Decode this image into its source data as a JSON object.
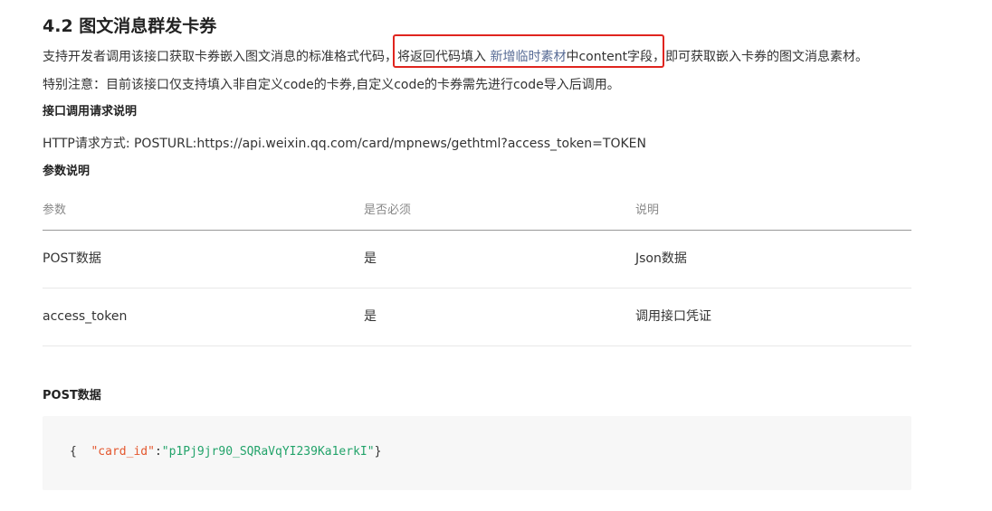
{
  "heading": "4.2 图文消息群发卡券",
  "para1": {
    "before": "支持开发者调用该接口获取卡券嵌入图文消息的标准格式代码，",
    "boxed_before": "将返回代码填入 ",
    "link": "新增临时素材",
    "boxed_after": "中content字段，",
    "after": "即可获取嵌入卡券的图文消息素材。"
  },
  "para2": "特别注意：目前该接口仅支持填入非自定义code的卡券,自定义code的卡券需先进行code导入后调用。",
  "request_title": "接口调用请求说明",
  "http_line": "HTTP请求方式: POSTURL:https://api.weixin.qq.com/card/mpnews/gethtml?access_token=TOKEN",
  "params_title": "参数说明",
  "table": {
    "headers": [
      "参数",
      "是否必须",
      "说明"
    ],
    "rows": [
      [
        "POST数据",
        "是",
        "Json数据"
      ],
      [
        "access_token",
        "是",
        "调用接口凭证"
      ]
    ]
  },
  "post_title": "POST数据",
  "code": {
    "open": "{  ",
    "key": "\"card_id\"",
    "colon": ":",
    "value": "\"p1Pj9jr90_SQRaVqYI239Ka1erkI\"",
    "close": "}"
  },
  "colors": {
    "link": "#576b95",
    "highlight_border": "#e0251f",
    "code_key": "#e4572e",
    "code_string": "#22a36a"
  }
}
